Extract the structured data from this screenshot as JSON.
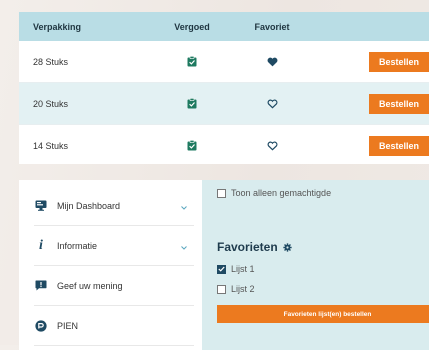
{
  "table": {
    "headers": {
      "packaging": "Verpakking",
      "reimbursed": "Vergoed",
      "favorite": "Favoriet"
    },
    "rows": [
      {
        "packaging": "28 Stuks",
        "reimbursed": true,
        "favorite": true,
        "order_label": "Bestellen"
      },
      {
        "packaging": "20 Stuks",
        "reimbursed": true,
        "favorite": false,
        "order_label": "Bestellen"
      },
      {
        "packaging": "14 Stuks",
        "reimbursed": true,
        "favorite": false,
        "order_label": "Bestellen"
      }
    ]
  },
  "sidebar": {
    "items": [
      {
        "label": "Mijn Dashboard",
        "icon": "dashboard-icon",
        "expandable": true
      },
      {
        "label": "Informatie",
        "icon": "info-icon",
        "expandable": true
      },
      {
        "label": "Geef uw mening",
        "icon": "feedback-icon",
        "expandable": false
      },
      {
        "label": "PIEN",
        "icon": "pien-icon",
        "expandable": false
      }
    ]
  },
  "content": {
    "show_authorized_label": "Toon alleen gemachtigde",
    "show_authorized_checked": false,
    "favorites_title": "Favorieten",
    "lists": [
      {
        "label": "Lijst 1",
        "checked": true
      },
      {
        "label": "Lijst 2",
        "checked": false
      }
    ],
    "order_favorites_label": "Favorieten lijst(en) bestellen"
  },
  "colors": {
    "accent_orange": "#ec7a1f",
    "header_blue": "#b9dde5",
    "alt_row": "#e3f1f3",
    "icon_green": "#1e7a60",
    "heart_navy": "#1f4a63"
  }
}
